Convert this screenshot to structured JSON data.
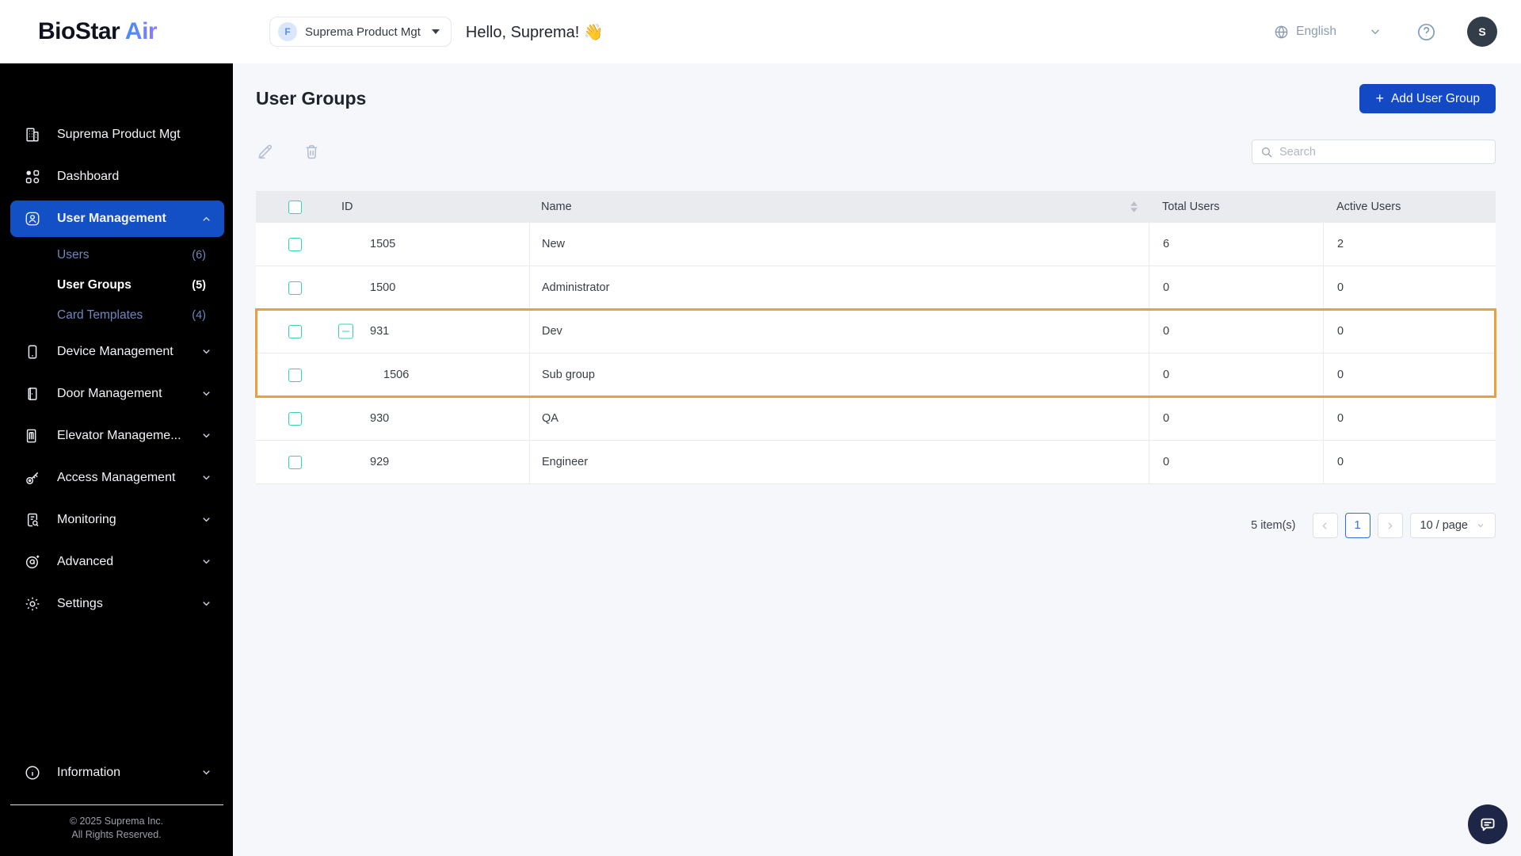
{
  "colors": {
    "primary_blue": "#1449C6",
    "sidebar_active_blue": "#1350C5",
    "checkbox_teal": "#35D3B4",
    "highlight_orange": "#E9A23B",
    "sidebar_bg": "#000000",
    "table_header_bg": "#E9EBEF"
  },
  "brand": {
    "name_primary": "BioStar",
    "name_secondary": "Air"
  },
  "header": {
    "org_selector": {
      "badge": "F",
      "label": "Suprema Product Mgt",
      "caret_icon": "caret-down-icon"
    },
    "greeting": "Hello, Suprema! 👋",
    "language": {
      "icon": "globe-icon",
      "label": "English",
      "chevron_icon": "chevron-down-icon"
    },
    "help_icon": "help-icon",
    "avatar_initial": "S"
  },
  "sidebar": {
    "items": [
      {
        "label": "Suprema Product Mgt",
        "icon": "building",
        "type": "top"
      },
      {
        "label": "Dashboard",
        "icon": "dashboard",
        "type": "top"
      },
      {
        "label": "User Management",
        "icon": "user",
        "type": "top",
        "active": true,
        "chevron": "up"
      },
      {
        "label": "Users",
        "count": "(6)",
        "type": "sub"
      },
      {
        "label": "User Groups",
        "count": "(5)",
        "type": "sub",
        "active": true
      },
      {
        "label": "Card Templates",
        "count": "(4)",
        "type": "sub"
      },
      {
        "label": "Device Management",
        "icon": "device",
        "type": "top",
        "chevron": "down"
      },
      {
        "label": "Door Management",
        "icon": "door",
        "type": "top",
        "chevron": "down"
      },
      {
        "label": "Elevator Manageme...",
        "icon": "elevator",
        "type": "top",
        "chevron": "down"
      },
      {
        "label": "Access Management",
        "icon": "key",
        "type": "top",
        "chevron": "down"
      },
      {
        "label": "Monitoring",
        "icon": "monitoring",
        "type": "top",
        "chevron": "down"
      },
      {
        "label": "Advanced",
        "icon": "advanced",
        "type": "top",
        "chevron": "down"
      },
      {
        "label": "Settings",
        "icon": "gear",
        "type": "top",
        "chevron": "down"
      }
    ],
    "information_item": {
      "label": "Information",
      "icon": "info",
      "chevron": "down"
    },
    "copyright_line1": "© 2025 Suprema Inc.",
    "copyright_line2": "All Rights Reserved."
  },
  "page": {
    "title": "User Groups",
    "add_button": {
      "plus": "+",
      "label": "Add User Group"
    },
    "toolbar_icons": [
      "edit-icon",
      "delete-icon"
    ],
    "search_placeholder": "Search"
  },
  "table": {
    "columns": {
      "id": "ID",
      "name": "Name",
      "total": "Total Users",
      "active": "Active Users"
    },
    "sort_icon_column": "Name",
    "rows": [
      {
        "id": "1505",
        "name": "New",
        "total_users": "6",
        "active_users": "2"
      },
      {
        "id": "1500",
        "name": "Administrator",
        "total_users": "0",
        "active_users": "0"
      },
      {
        "id": "931",
        "name": "Dev",
        "total_users": "0",
        "active_users": "0",
        "expandable": true,
        "highlighted": true
      },
      {
        "id": "1506",
        "name": "Sub group",
        "total_users": "0",
        "active_users": "0",
        "child": true,
        "highlighted": true
      },
      {
        "id": "930",
        "name": "QA",
        "total_users": "0",
        "active_users": "0"
      },
      {
        "id": "929",
        "name": "Engineer",
        "total_users": "0",
        "active_users": "0"
      }
    ]
  },
  "pagination": {
    "items_text": "5 item(s)",
    "current_page": "1",
    "page_size": "10 / page"
  }
}
